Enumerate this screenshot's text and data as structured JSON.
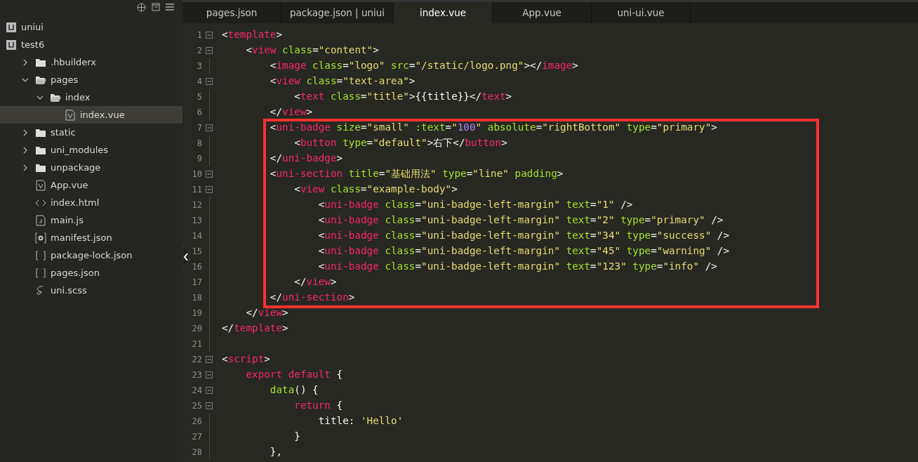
{
  "sidebar": {
    "items": [
      {
        "label": "uniui",
        "kind": "project",
        "selected": false
      },
      {
        "label": "test6",
        "kind": "project",
        "selected": false,
        "children": [
          {
            "label": ".hbuilderx",
            "kind": "folder",
            "expanded": false,
            "selected": false
          },
          {
            "label": "pages",
            "kind": "folder",
            "expanded": true,
            "selected": false,
            "children": [
              {
                "label": "index",
                "kind": "folder",
                "expanded": true,
                "selected": false,
                "children": [
                  {
                    "label": "index.vue",
                    "kind": "vue",
                    "selected": true
                  }
                ]
              }
            ]
          },
          {
            "label": "static",
            "kind": "folder",
            "expanded": false,
            "selected": false
          },
          {
            "label": "uni_modules",
            "kind": "folder",
            "expanded": false,
            "selected": false
          },
          {
            "label": "unpackage",
            "kind": "folder",
            "expanded": false,
            "selected": false
          },
          {
            "label": "App.vue",
            "kind": "vue",
            "selected": false
          },
          {
            "label": "index.html",
            "kind": "html",
            "selected": false
          },
          {
            "label": "main.js",
            "kind": "js",
            "selected": false
          },
          {
            "label": "manifest.json",
            "kind": "manifest",
            "selected": false
          },
          {
            "label": "package-lock.json",
            "kind": "json",
            "selected": false
          },
          {
            "label": "pages.json",
            "kind": "json",
            "selected": false
          },
          {
            "label": "uni.scss",
            "kind": "scss",
            "selected": false
          }
        ]
      }
    ]
  },
  "tabs": [
    {
      "label": "pages.json",
      "selected": false
    },
    {
      "label": "package.json | uniui",
      "selected": false
    },
    {
      "label": "index.vue",
      "selected": true
    },
    {
      "label": "App.vue",
      "selected": false
    },
    {
      "label": "uni-ui.vue",
      "selected": false
    }
  ],
  "editor": {
    "lines": [
      {
        "number": "1",
        "foldable": true,
        "highlighted": false,
        "tokens": [
          {
            "kind": "punct",
            "text": "<"
          },
          {
            "kind": "tag",
            "text": "template"
          },
          {
            "kind": "punct",
            "text": ">"
          }
        ]
      },
      {
        "number": "2",
        "foldable": true,
        "highlighted": false,
        "tokens": [
          {
            "kind": "punct",
            "text": "    <"
          },
          {
            "kind": "tag",
            "text": "view"
          },
          {
            "kind": "attr",
            "text": " class"
          },
          {
            "kind": "punct",
            "text": "="
          },
          {
            "kind": "string",
            "text": "\"content\""
          },
          {
            "kind": "punct",
            "text": ">"
          }
        ]
      },
      {
        "number": "3",
        "foldable": false,
        "highlighted": false,
        "tokens": [
          {
            "kind": "punct",
            "text": "        <"
          },
          {
            "kind": "tag",
            "text": "image"
          },
          {
            "kind": "attr",
            "text": " class"
          },
          {
            "kind": "punct",
            "text": "="
          },
          {
            "kind": "string",
            "text": "\"logo\""
          },
          {
            "kind": "attr",
            "text": " src"
          },
          {
            "kind": "punct",
            "text": "="
          },
          {
            "kind": "string",
            "text": "\"/static/logo.png\""
          },
          {
            "kind": "punct",
            "text": "></"
          },
          {
            "kind": "tag",
            "text": "image"
          },
          {
            "kind": "punct",
            "text": ">"
          }
        ]
      },
      {
        "number": "4",
        "foldable": true,
        "highlighted": false,
        "tokens": [
          {
            "kind": "punct",
            "text": "        <"
          },
          {
            "kind": "tag",
            "text": "view"
          },
          {
            "kind": "attr",
            "text": " class"
          },
          {
            "kind": "punct",
            "text": "="
          },
          {
            "kind": "string",
            "text": "\"text-area\""
          },
          {
            "kind": "punct",
            "text": ">"
          }
        ]
      },
      {
        "number": "5",
        "foldable": false,
        "highlighted": false,
        "tokens": [
          {
            "kind": "punct",
            "text": "            <"
          },
          {
            "kind": "tag",
            "text": "text"
          },
          {
            "kind": "attr",
            "text": " class"
          },
          {
            "kind": "punct",
            "text": "="
          },
          {
            "kind": "string",
            "text": "\"title\""
          },
          {
            "kind": "punct",
            "text": ">{{title}}</"
          },
          {
            "kind": "tag",
            "text": "text"
          },
          {
            "kind": "punct",
            "text": ">"
          }
        ]
      },
      {
        "number": "6",
        "foldable": false,
        "highlighted": false,
        "tokens": [
          {
            "kind": "punct",
            "text": "        </"
          },
          {
            "kind": "tag",
            "text": "view"
          },
          {
            "kind": "punct",
            "text": ">"
          }
        ]
      },
      {
        "number": "7",
        "foldable": true,
        "highlighted": true,
        "tokens": [
          {
            "kind": "punct",
            "text": "        <"
          },
          {
            "kind": "tag",
            "text": "uni-badge"
          },
          {
            "kind": "attr",
            "text": " size"
          },
          {
            "kind": "punct",
            "text": "="
          },
          {
            "kind": "string",
            "text": "\"small\""
          },
          {
            "kind": "attr",
            "text": " :text"
          },
          {
            "kind": "punct",
            "text": "="
          },
          {
            "kind": "string",
            "text": "\""
          },
          {
            "kind": "number",
            "text": "100"
          },
          {
            "kind": "string",
            "text": "\""
          },
          {
            "kind": "attr",
            "text": " absolute"
          },
          {
            "kind": "punct",
            "text": "="
          },
          {
            "kind": "string",
            "text": "\"rightBottom\""
          },
          {
            "kind": "attr",
            "text": " type"
          },
          {
            "kind": "punct",
            "text": "="
          },
          {
            "kind": "string",
            "text": "\"primary\""
          },
          {
            "kind": "punct",
            "text": ">"
          }
        ]
      },
      {
        "number": "8",
        "foldable": false,
        "highlighted": true,
        "tokens": [
          {
            "kind": "punct",
            "text": "            <"
          },
          {
            "kind": "tag",
            "text": "button"
          },
          {
            "kind": "attr",
            "text": " type"
          },
          {
            "kind": "punct",
            "text": "="
          },
          {
            "kind": "string",
            "text": "\"default\""
          },
          {
            "kind": "punct",
            "text": ">右下</"
          },
          {
            "kind": "tag",
            "text": "button"
          },
          {
            "kind": "punct",
            "text": ">"
          }
        ]
      },
      {
        "number": "9",
        "foldable": false,
        "highlighted": true,
        "tokens": [
          {
            "kind": "punct",
            "text": "        </"
          },
          {
            "kind": "tag",
            "text": "uni-badge"
          },
          {
            "kind": "punct",
            "text": ">"
          }
        ]
      },
      {
        "number": "10",
        "foldable": true,
        "highlighted": true,
        "tokens": [
          {
            "kind": "punct",
            "text": "        <"
          },
          {
            "kind": "tag",
            "text": "uni-section"
          },
          {
            "kind": "attr",
            "text": " title"
          },
          {
            "kind": "punct",
            "text": "="
          },
          {
            "kind": "string",
            "text": "\"基础用法\""
          },
          {
            "kind": "attr",
            "text": " type"
          },
          {
            "kind": "punct",
            "text": "="
          },
          {
            "kind": "string",
            "text": "\"line\""
          },
          {
            "kind": "attr",
            "text": " padding"
          },
          {
            "kind": "punct",
            "text": ">"
          }
        ]
      },
      {
        "number": "11",
        "foldable": true,
        "highlighted": true,
        "tokens": [
          {
            "kind": "punct",
            "text": "            <"
          },
          {
            "kind": "tag",
            "text": "view"
          },
          {
            "kind": "attr",
            "text": " class"
          },
          {
            "kind": "punct",
            "text": "="
          },
          {
            "kind": "string",
            "text": "\"example-body\""
          },
          {
            "kind": "punct",
            "text": ">"
          }
        ]
      },
      {
        "number": "12",
        "foldable": false,
        "highlighted": true,
        "tokens": [
          {
            "kind": "punct",
            "text": "                <"
          },
          {
            "kind": "tag",
            "text": "uni-badge"
          },
          {
            "kind": "attr",
            "text": " class"
          },
          {
            "kind": "punct",
            "text": "="
          },
          {
            "kind": "string",
            "text": "\"uni-badge-left-margin\""
          },
          {
            "kind": "attr",
            "text": " text"
          },
          {
            "kind": "punct",
            "text": "="
          },
          {
            "kind": "string",
            "text": "\"1\""
          },
          {
            "kind": "punct",
            "text": " />"
          }
        ]
      },
      {
        "number": "13",
        "foldable": false,
        "highlighted": true,
        "tokens": [
          {
            "kind": "punct",
            "text": "                <"
          },
          {
            "kind": "tag",
            "text": "uni-badge"
          },
          {
            "kind": "attr",
            "text": " class"
          },
          {
            "kind": "punct",
            "text": "="
          },
          {
            "kind": "string",
            "text": "\"uni-badge-left-margin\""
          },
          {
            "kind": "attr",
            "text": " text"
          },
          {
            "kind": "punct",
            "text": "="
          },
          {
            "kind": "string",
            "text": "\"2\""
          },
          {
            "kind": "attr",
            "text": " type"
          },
          {
            "kind": "punct",
            "text": "="
          },
          {
            "kind": "string",
            "text": "\"primary\""
          },
          {
            "kind": "punct",
            "text": " />"
          }
        ]
      },
      {
        "number": "14",
        "foldable": false,
        "highlighted": true,
        "tokens": [
          {
            "kind": "punct",
            "text": "                <"
          },
          {
            "kind": "tag",
            "text": "uni-badge"
          },
          {
            "kind": "attr",
            "text": " class"
          },
          {
            "kind": "punct",
            "text": "="
          },
          {
            "kind": "string",
            "text": "\"uni-badge-left-margin\""
          },
          {
            "kind": "attr",
            "text": " text"
          },
          {
            "kind": "punct",
            "text": "="
          },
          {
            "kind": "string",
            "text": "\"34\""
          },
          {
            "kind": "attr",
            "text": " type"
          },
          {
            "kind": "punct",
            "text": "="
          },
          {
            "kind": "string",
            "text": "\"success\""
          },
          {
            "kind": "punct",
            "text": " />"
          }
        ]
      },
      {
        "number": "15",
        "foldable": false,
        "highlighted": true,
        "tokens": [
          {
            "kind": "punct",
            "text": "                <"
          },
          {
            "kind": "tag",
            "text": "uni-badge"
          },
          {
            "kind": "attr",
            "text": " class"
          },
          {
            "kind": "punct",
            "text": "="
          },
          {
            "kind": "string",
            "text": "\"uni-badge-left-margin\""
          },
          {
            "kind": "attr",
            "text": " text"
          },
          {
            "kind": "punct",
            "text": "="
          },
          {
            "kind": "string",
            "text": "\"45\""
          },
          {
            "kind": "attr",
            "text": " type"
          },
          {
            "kind": "punct",
            "text": "="
          },
          {
            "kind": "string",
            "text": "\"warning\""
          },
          {
            "kind": "punct",
            "text": " />"
          }
        ]
      },
      {
        "number": "16",
        "foldable": false,
        "highlighted": true,
        "tokens": [
          {
            "kind": "punct",
            "text": "                <"
          },
          {
            "kind": "tag",
            "text": "uni-badge"
          },
          {
            "kind": "attr",
            "text": " class"
          },
          {
            "kind": "punct",
            "text": "="
          },
          {
            "kind": "string",
            "text": "\"uni-badge-left-margin\""
          },
          {
            "kind": "attr",
            "text": " text"
          },
          {
            "kind": "punct",
            "text": "="
          },
          {
            "kind": "string",
            "text": "\"123\""
          },
          {
            "kind": "attr",
            "text": " type"
          },
          {
            "kind": "punct",
            "text": "="
          },
          {
            "kind": "string",
            "text": "\"info\""
          },
          {
            "kind": "punct",
            "text": " />"
          }
        ]
      },
      {
        "number": "17",
        "foldable": false,
        "highlighted": true,
        "tokens": [
          {
            "kind": "punct",
            "text": "            </"
          },
          {
            "kind": "tag",
            "text": "view"
          },
          {
            "kind": "punct",
            "text": ">"
          }
        ]
      },
      {
        "number": "18",
        "foldable": false,
        "highlighted": true,
        "tokens": [
          {
            "kind": "punct",
            "text": "        </"
          },
          {
            "kind": "tag",
            "text": "uni-section"
          },
          {
            "kind": "punct",
            "text": ">"
          }
        ]
      },
      {
        "number": "19",
        "foldable": false,
        "highlighted": false,
        "tokens": [
          {
            "kind": "punct",
            "text": "    </"
          },
          {
            "kind": "tag",
            "text": "view"
          },
          {
            "kind": "punct",
            "text": ">"
          }
        ]
      },
      {
        "number": "20",
        "foldable": false,
        "highlighted": false,
        "tokens": [
          {
            "kind": "punct",
            "text": "</"
          },
          {
            "kind": "tag",
            "text": "template"
          },
          {
            "kind": "punct",
            "text": ">"
          }
        ]
      },
      {
        "number": "21",
        "foldable": false,
        "highlighted": false
      },
      {
        "number": "22",
        "foldable": true,
        "highlighted": false,
        "tokens": [
          {
            "kind": "punct",
            "text": "<"
          },
          {
            "kind": "tag",
            "text": "script"
          },
          {
            "kind": "punct",
            "text": ">"
          }
        ]
      },
      {
        "number": "23",
        "foldable": true,
        "highlighted": false,
        "tokens": [
          {
            "kind": "tag",
            "text": "    export default"
          },
          {
            "kind": "punct",
            "text": " {"
          }
        ]
      },
      {
        "number": "24",
        "foldable": true,
        "highlighted": false,
        "tokens": [
          {
            "kind": "attr",
            "text": "        data"
          },
          {
            "kind": "punct",
            "text": "() {"
          }
        ]
      },
      {
        "number": "25",
        "foldable": true,
        "highlighted": false,
        "tokens": [
          {
            "kind": "tag",
            "text": "            return"
          },
          {
            "kind": "punct",
            "text": " {"
          }
        ]
      },
      {
        "number": "26",
        "foldable": false,
        "highlighted": false,
        "tokens": [
          {
            "kind": "punct",
            "text": "                title: "
          },
          {
            "kind": "string",
            "text": "'Hello'"
          }
        ]
      },
      {
        "number": "27",
        "foldable": false,
        "highlighted": false,
        "tokens": [
          {
            "kind": "punct",
            "text": "            }"
          }
        ]
      },
      {
        "number": "28",
        "foldable": false,
        "highlighted": false,
        "tokens": [
          {
            "kind": "punct",
            "text": "        },"
          }
        ]
      }
    ]
  }
}
